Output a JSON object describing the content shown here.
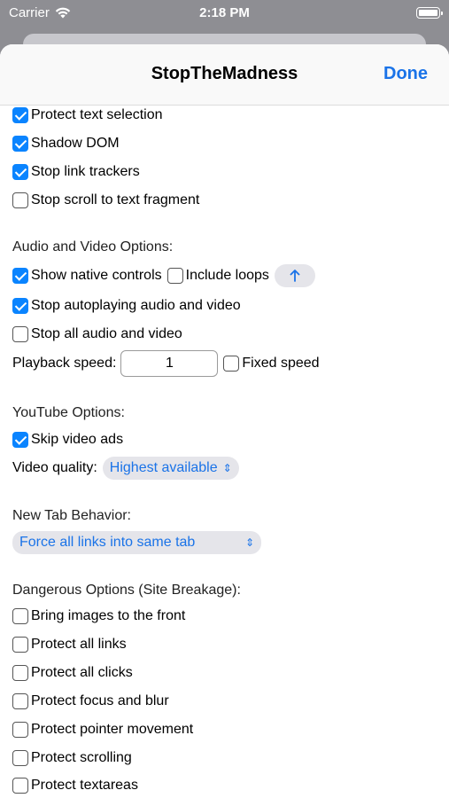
{
  "status": {
    "carrier": "Carrier",
    "time": "2:18 PM"
  },
  "nav": {
    "title": "StopTheMadness",
    "done": "Done"
  },
  "options": {
    "protect_text_selection": {
      "label": "Protect text selection",
      "checked": true
    },
    "shadow_dom": {
      "label": "Shadow DOM",
      "checked": true
    },
    "stop_link_trackers": {
      "label": "Stop link trackers",
      "checked": true
    },
    "stop_scroll_fragment": {
      "label": "Stop scroll to text fragment",
      "checked": false
    }
  },
  "audio_video": {
    "header": "Audio and Video Options:",
    "show_native_controls": {
      "label": "Show native controls",
      "checked": true
    },
    "include_loops": {
      "label": "Include loops",
      "checked": false
    },
    "stop_autoplaying": {
      "label": "Stop autoplaying audio and video",
      "checked": true
    },
    "stop_all": {
      "label": "Stop all audio and video",
      "checked": false
    },
    "playback_speed_label": "Playback speed:",
    "playback_speed_value": "1",
    "fixed_speed": {
      "label": "Fixed speed",
      "checked": false
    }
  },
  "youtube": {
    "header": "YouTube Options:",
    "skip_video_ads": {
      "label": "Skip video ads",
      "checked": true
    },
    "video_quality_label": "Video quality:",
    "video_quality_value": "Highest available"
  },
  "new_tab": {
    "header": "New Tab Behavior:",
    "value": "Force all links into same tab"
  },
  "dangerous": {
    "header": "Dangerous Options (Site Breakage):",
    "items": [
      {
        "label": "Bring images to the front",
        "checked": false
      },
      {
        "label": "Protect all links",
        "checked": false
      },
      {
        "label": "Protect all clicks",
        "checked": false
      },
      {
        "label": "Protect focus and blur",
        "checked": false
      },
      {
        "label": "Protect pointer movement",
        "checked": false
      },
      {
        "label": "Protect scrolling",
        "checked": false
      },
      {
        "label": "Protect textareas",
        "checked": false
      }
    ]
  },
  "colors": {
    "accent": "#0a84ff",
    "link": "#1a73e8",
    "pill_bg": "#e5e5ea"
  }
}
